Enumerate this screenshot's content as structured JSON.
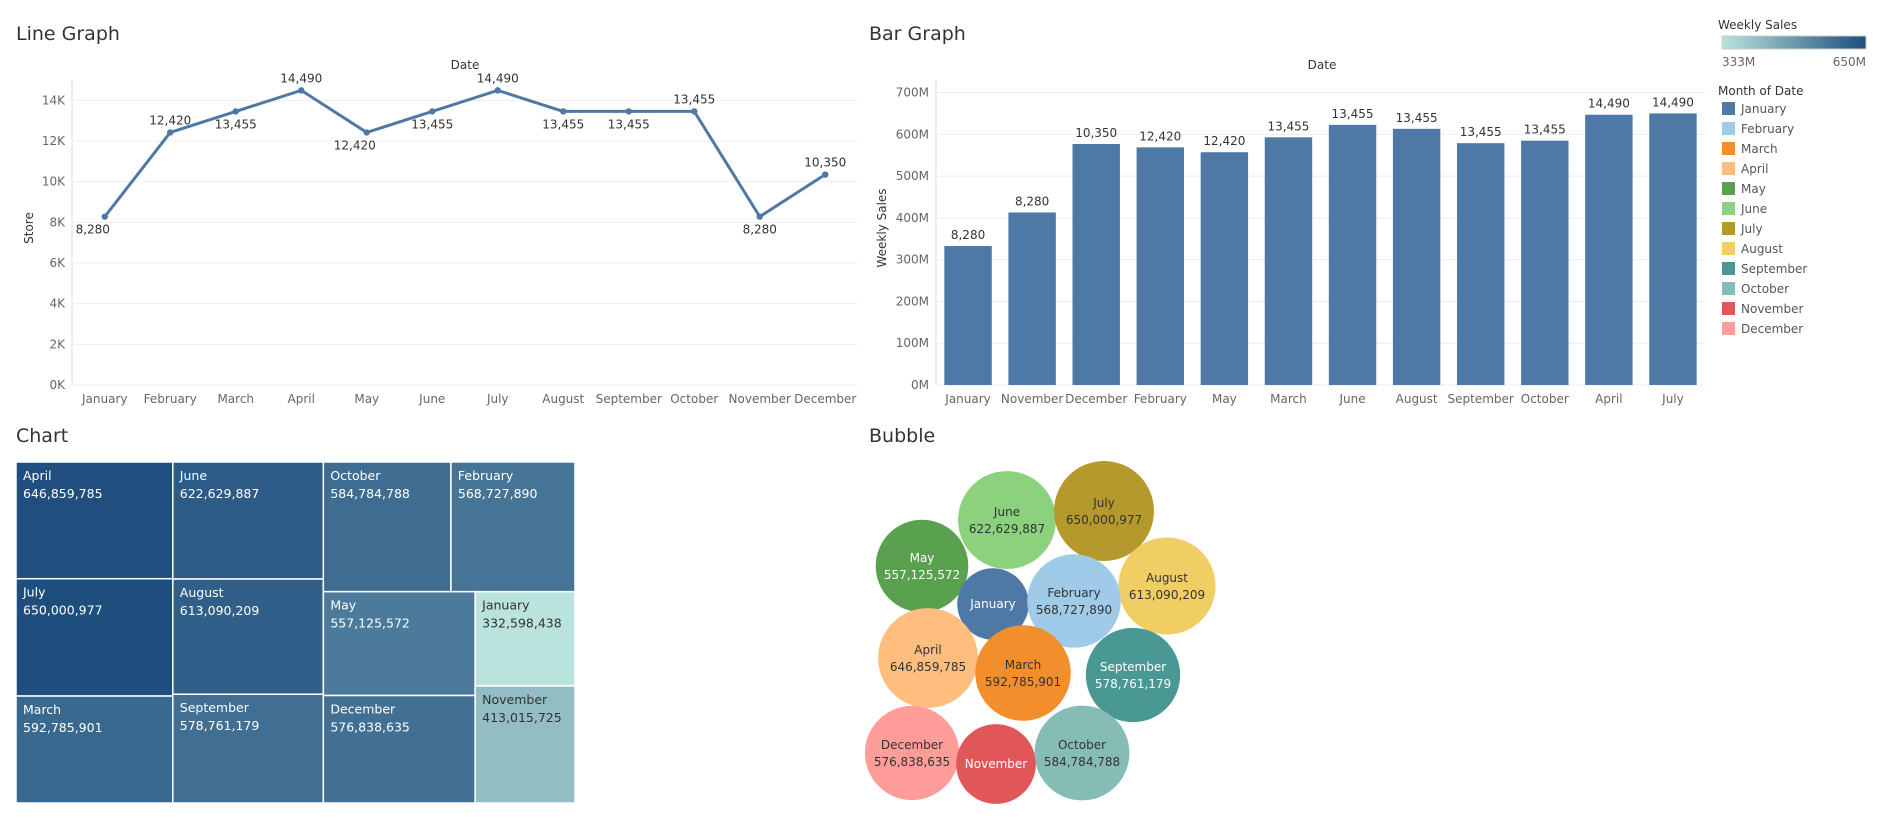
{
  "line_graph": {
    "title": "Line Graph"
  },
  "bar_graph": {
    "title": "Bar Graph"
  },
  "treemap_panel": {
    "title": "Chart"
  },
  "bubble_panel": {
    "title": "Bubble"
  },
  "legend": {
    "gradient_title": "Weekly Sales",
    "gradient_min": "333M",
    "gradient_max": "650M",
    "gradient_colors": [
      "#b9e3dc",
      "#1e4e7e"
    ],
    "month_title": "Month of Date"
  },
  "colors": {
    "line": "#4e79a7",
    "bar": "#4e79a7"
  },
  "months": [
    {
      "name": "January",
      "color": "#4e79a7"
    },
    {
      "name": "February",
      "color": "#a0cbe8"
    },
    {
      "name": "March",
      "color": "#f28e2b"
    },
    {
      "name": "April",
      "color": "#ffbe7d"
    },
    {
      "name": "May",
      "color": "#59a14f"
    },
    {
      "name": "June",
      "color": "#8cd17d"
    },
    {
      "name": "July",
      "color": "#b6992d"
    },
    {
      "name": "August",
      "color": "#f1ce63"
    },
    {
      "name": "September",
      "color": "#499894"
    },
    {
      "name": "October",
      "color": "#86bcb6"
    },
    {
      "name": "November",
      "color": "#e15759"
    },
    {
      "name": "December",
      "color": "#ff9d9a"
    }
  ],
  "chart_data": [
    {
      "type": "line",
      "title": "Line Graph",
      "xlabel": "Date",
      "ylabel": "Store",
      "categories": [
        "January",
        "February",
        "March",
        "April",
        "May",
        "June",
        "July",
        "August",
        "September",
        "October",
        "November",
        "December"
      ],
      "values": [
        8280,
        12420,
        13455,
        14490,
        12420,
        13455,
        14490,
        13455,
        13455,
        13455,
        8280,
        10350
      ],
      "data_labels": [
        "8,280",
        "12,420",
        "13,455",
        "14,490",
        "12,420",
        "13,455",
        "14,490",
        "13,455",
        "13,455",
        "13,455",
        "8,280",
        "10,350"
      ],
      "label_position": [
        "below",
        "above",
        "below",
        "above",
        "below",
        "below",
        "above",
        "below",
        "below",
        "above",
        "below",
        "above"
      ],
      "ylim": [
        0,
        15000
      ],
      "yticks": [
        0,
        2000,
        4000,
        6000,
        8000,
        10000,
        12000,
        14000
      ],
      "ytick_labels": [
        "0K",
        "2K",
        "4K",
        "6K",
        "8K",
        "10K",
        "12K",
        "14K"
      ],
      "grid": true
    },
    {
      "type": "bar",
      "title": "Bar Graph",
      "xlabel": "Date",
      "ylabel": "Weekly Sales",
      "categories": [
        "January",
        "November",
        "December",
        "February",
        "May",
        "March",
        "June",
        "August",
        "September",
        "October",
        "April",
        "July"
      ],
      "values": [
        332598438,
        413015725,
        576838635,
        568727890,
        557125572,
        592785901,
        622629887,
        613090209,
        578761179,
        584784788,
        646859785,
        650000977
      ],
      "data_labels": [
        "8,280",
        "8,280",
        "10,350",
        "12,420",
        "12,420",
        "13,455",
        "13,455",
        "13,455",
        "13,455",
        "13,455",
        "14,490",
        "14,490"
      ],
      "ylim": [
        0,
        730000000
      ],
      "yticks": [
        0,
        100000000,
        200000000,
        300000000,
        400000000,
        500000000,
        600000000,
        700000000
      ],
      "ytick_labels": [
        "0M",
        "100M",
        "200M",
        "300M",
        "400M",
        "500M",
        "600M",
        "700M"
      ],
      "grid": true
    },
    {
      "type": "treemap",
      "title": "Chart",
      "items": [
        {
          "name": "April",
          "value": 646859785,
          "label": "646,859,785"
        },
        {
          "name": "July",
          "value": 650000977,
          "label": "650,000,977"
        },
        {
          "name": "March",
          "value": 592785901,
          "label": "592,785,901"
        },
        {
          "name": "June",
          "value": 622629887,
          "label": "622,629,887"
        },
        {
          "name": "August",
          "value": 613090209,
          "label": "613,090,209"
        },
        {
          "name": "September",
          "value": 578761179,
          "label": "578,761,179"
        },
        {
          "name": "October",
          "value": 584784788,
          "label": "584,784,788"
        },
        {
          "name": "February",
          "value": 568727890,
          "label": "568,727,890"
        },
        {
          "name": "May",
          "value": 557125572,
          "label": "557,125,572"
        },
        {
          "name": "January",
          "value": 332598438,
          "label": "332,598,438"
        },
        {
          "name": "December",
          "value": 576838635,
          "label": "576,838,635"
        },
        {
          "name": "November",
          "value": 413015725,
          "label": "413,015,725"
        }
      ]
    },
    {
      "type": "bubble",
      "title": "Bubble",
      "items": [
        {
          "name": "June",
          "value": 622629887,
          "label": "622,629,887"
        },
        {
          "name": "July",
          "value": 650000977,
          "label": "650,000,977"
        },
        {
          "name": "May",
          "value": 557125572,
          "label": "557,125,572"
        },
        {
          "name": "August",
          "value": 613090209,
          "label": "613,090,209"
        },
        {
          "name": "January",
          "value": 332598438,
          "label": ""
        },
        {
          "name": "February",
          "value": 568727890,
          "label": "568,727,890"
        },
        {
          "name": "April",
          "value": 646859785,
          "label": "646,859,785"
        },
        {
          "name": "March",
          "value": 592785901,
          "label": "592,785,901"
        },
        {
          "name": "September",
          "value": 578761179,
          "label": "578,761,179"
        },
        {
          "name": "December",
          "value": 576838635,
          "label": "576,838,635"
        },
        {
          "name": "November",
          "value": 413015725,
          "label": ""
        },
        {
          "name": "October",
          "value": 584784788,
          "label": "584,784,788"
        }
      ]
    }
  ]
}
